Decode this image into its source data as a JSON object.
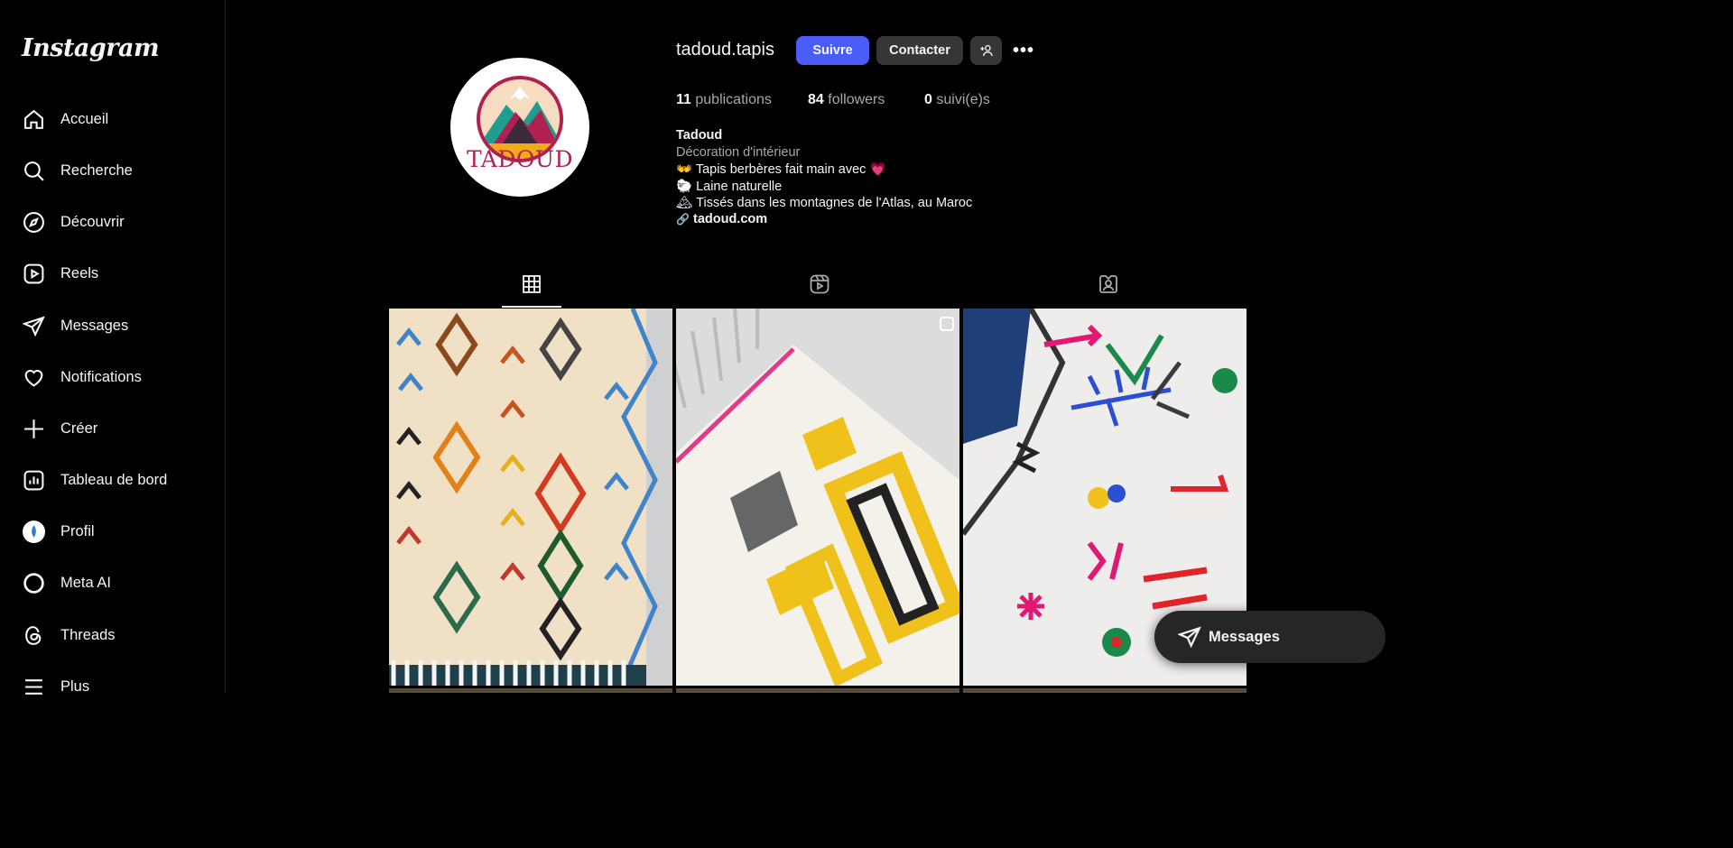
{
  "app": {
    "logo_text": "Instagram"
  },
  "sidebar": {
    "items": [
      {
        "label": "Accueil",
        "icon": "home-icon"
      },
      {
        "label": "Recherche",
        "icon": "search-icon"
      },
      {
        "label": "Découvrir",
        "icon": "compass-icon"
      },
      {
        "label": "Reels",
        "icon": "reels-icon"
      },
      {
        "label": "Messages",
        "icon": "send-icon"
      },
      {
        "label": "Notifications",
        "icon": "heart-icon"
      },
      {
        "label": "Créer",
        "icon": "plus-icon"
      },
      {
        "label": "Tableau de bord",
        "icon": "dashboard-icon"
      },
      {
        "label": "Profil",
        "icon": "avatar-icon"
      },
      {
        "label": "Meta AI",
        "icon": "meta-ai-icon"
      },
      {
        "label": "Threads",
        "icon": "threads-icon"
      },
      {
        "label": "Plus",
        "icon": "menu-icon"
      }
    ]
  },
  "profile": {
    "avatar_text": "TADOUD",
    "username": "tadoud.tapis",
    "follow_label": "Suivre",
    "contact_label": "Contacter",
    "more_label": "•••",
    "stats": {
      "posts_count": "11",
      "posts_label": "publications",
      "followers_count": "84",
      "followers_label": "followers",
      "following_count": "0",
      "following_label": "suivi(e)s"
    },
    "bio": {
      "name": "Tadoud",
      "category": "Décoration d'intérieur",
      "line1": "👐 Tapis berbères fait main avec 💗",
      "line2": "🐑 Laine naturelle",
      "line3": "🏔 Tissés dans les montagnes de l'Atlas, au Maroc",
      "link_icon": "🔗",
      "link": "tadoud.com"
    }
  },
  "tabs": [
    {
      "name": "posts",
      "icon": "grid-icon",
      "active": true
    },
    {
      "name": "reels",
      "icon": "reels-icon",
      "active": false
    },
    {
      "name": "tagged",
      "icon": "tagged-icon",
      "active": false
    }
  ],
  "floating": {
    "messages_label": "Messages"
  },
  "colors": {
    "accent": "#4a5df9",
    "background": "#000000",
    "button_secondary": "#363636"
  }
}
